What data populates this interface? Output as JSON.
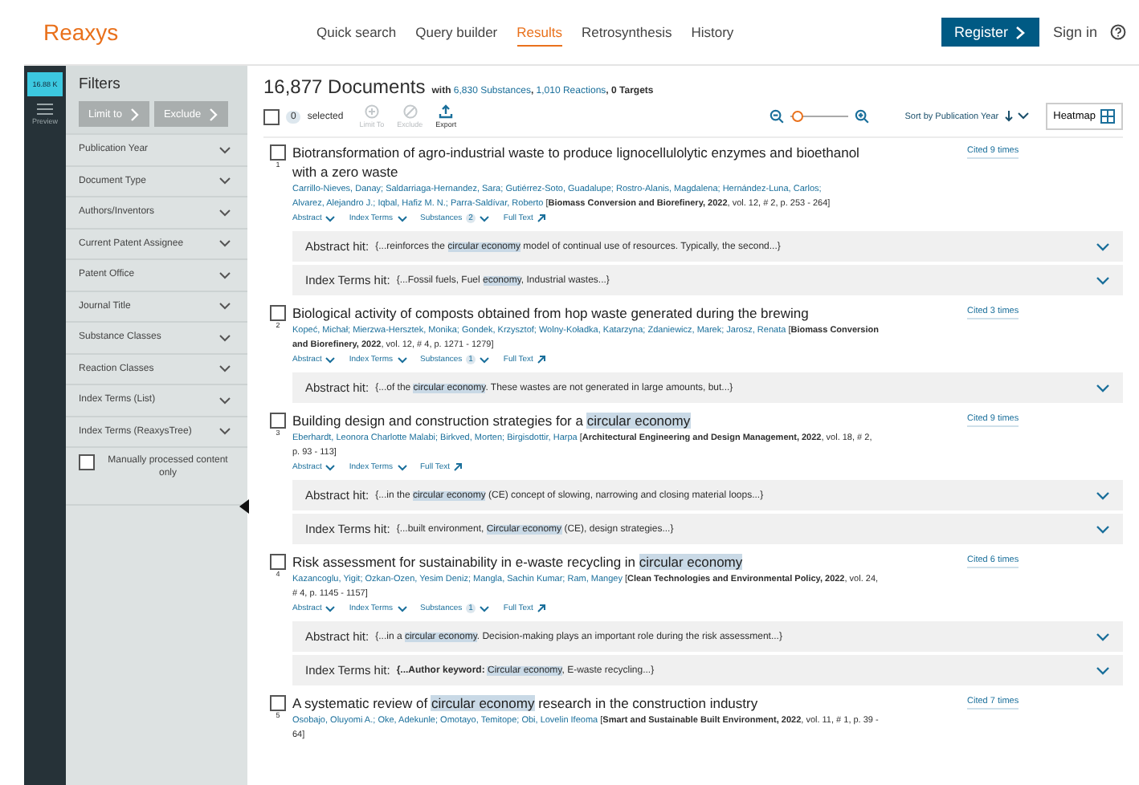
{
  "header": {
    "logo": "Reaxys",
    "nav": [
      {
        "label": "Quick search",
        "selected": false
      },
      {
        "label": "Query builder",
        "selected": false
      },
      {
        "label": "Results",
        "selected": true
      },
      {
        "label": "Retrosynthesis",
        "selected": false
      },
      {
        "label": "History",
        "selected": false
      }
    ],
    "register": "Register",
    "sign_in": "Sign in"
  },
  "rail": {
    "count": "16.88 K",
    "preview": "Preview"
  },
  "filters": {
    "title": "Filters",
    "buttons": [
      "Limit to",
      "Exclude"
    ],
    "items": [
      "Publication Year",
      "Document Type",
      "Authors/Inventors",
      "Current Patent Assignee",
      "Patent Office",
      "Journal Title",
      "Substance Classes",
      "Reaction Classes",
      "Index Terms (List)",
      "Index Terms (ReaxysTree)"
    ],
    "checkbox": {
      "label": "Manually processed content only",
      "checked": false
    }
  },
  "results": {
    "count": "16,877 Documents",
    "summary": [
      {
        "text": "with "
      },
      {
        "text": "6,830 Substances",
        "link": true
      },
      {
        "text": ", "
      },
      {
        "text": "1,010 Reactions",
        "link": true
      },
      {
        "text": ", 0 Targets"
      }
    ]
  },
  "toolbar": {
    "all_checked": false,
    "selected_count": "0",
    "selected_label": "selected",
    "actions": [
      {
        "label": "Limit To",
        "kind": "limit",
        "disabled": true
      },
      {
        "label": "Exclude",
        "kind": "exclude",
        "disabled": true
      },
      {
        "label": "Export",
        "kind": "export",
        "disabled": false
      }
    ],
    "zoom": {
      "level": 0.1
    },
    "sort": "Sort by Publication Year",
    "heatmap": "Heatmap"
  },
  "records": [
    {
      "number": "1",
      "checked": false,
      "cited": "Cited 9 times",
      "title": [
        {
          "text": "Biotransformation of agro-industrial waste to produce lignocellulolytic enzymes and bioethanol with a zero waste"
        }
      ],
      "authors": [
        "Carrillo-Nieves, Danay;",
        "Saldarriaga-Hernandez, Sara;",
        "Gutiérrez-Soto, Guadalupe;",
        "Rostro-Alanis, Magdalena;",
        "Hernández-Luna, Carlos;",
        "Alvarez, Alejandro J.;",
        "Iqbal, Hafiz M. N.;",
        "Parra-Saldívar, Roberto"
      ],
      "source": "[**Biomass Conversion and Biorefinery, 2022**, vol. 12, # 2, p. 253 - 264]",
      "links": [
        {
          "label": "Abstract",
          "kind": "dropdown"
        },
        {
          "label": "Index Terms",
          "kind": "dropdown"
        },
        {
          "label": "Substances",
          "kind": "dropdown",
          "count": "2"
        },
        {
          "label": "Full Text",
          "kind": "external"
        }
      ],
      "hits": [
        {
          "label": "Abstract hit:",
          "text": [
            {
              "text": "{...reinforces the "
            },
            {
              "text": "circular economy",
              "hl": true
            },
            {
              "text": " model of continual use of resources. Typically, the second...}"
            }
          ]
        },
        {
          "label": "Index Terms hit:",
          "text": [
            {
              "text": "{...Fossil fuels, Fuel "
            },
            {
              "text": "economy",
              "hl": true
            },
            {
              "text": ", Industrial wastes...}"
            }
          ]
        }
      ]
    },
    {
      "number": "2",
      "checked": false,
      "cited": "Cited 3 times",
      "title": [
        {
          "text": "Biological activity of composts obtained from hop waste generated during the brewing"
        }
      ],
      "authors": [
        "Kopeć, Michał;",
        "Mierzwa-Hersztek, Monika;",
        "Gondek, Krzysztof;",
        "Wolny-Koładka, Katarzyna;",
        "Zdaniewicz, Marek;",
        "Jarosz, Renata"
      ],
      "source": "[**Biomass Conversion and Biorefinery, 2022**, vol. 12, # 4, p. 1271 - 1279]",
      "links": [
        {
          "label": "Abstract",
          "kind": "dropdown"
        },
        {
          "label": "Index Terms",
          "kind": "dropdown"
        },
        {
          "label": "Substances",
          "kind": "dropdown",
          "count": "1"
        },
        {
          "label": "Full Text",
          "kind": "external"
        }
      ],
      "hits": [
        {
          "label": "Abstract hit:",
          "text": [
            {
              "text": "{...of the "
            },
            {
              "text": "circular economy",
              "hl": true
            },
            {
              "text": ". These wastes are not generated in large amounts, but...}"
            }
          ]
        }
      ]
    },
    {
      "number": "3",
      "checked": false,
      "cited": "Cited 9 times",
      "title": [
        {
          "text": "Building design and construction strategies for a "
        },
        {
          "text": "circular economy",
          "hl": true
        }
      ],
      "authors": [
        "Eberhardt, Leonora Charlotte Malabi;",
        "Birkved, Morten;",
        "Birgisdottir, Harpa"
      ],
      "source": "[**Architectural Engineering and Design Management, 2022**, vol. 18, # 2, p. 93 - 113]",
      "links": [
        {
          "label": "Abstract",
          "kind": "dropdown"
        },
        {
          "label": "Index Terms",
          "kind": "dropdown"
        },
        {
          "label": "Full Text",
          "kind": "external"
        }
      ],
      "hits": [
        {
          "label": "Abstract hit:",
          "text": [
            {
              "text": "{...in the "
            },
            {
              "text": "circular economy",
              "hl": true
            },
            {
              "text": " (CE) concept of slowing, narrowing and closing material loops...}"
            }
          ]
        },
        {
          "label": "Index Terms hit:",
          "text": [
            {
              "text": "{...built environment, "
            },
            {
              "text": "Circular economy",
              "hl": true
            },
            {
              "text": " (CE), design strategies...}"
            }
          ]
        }
      ]
    },
    {
      "number": "4",
      "checked": false,
      "cited": "Cited 6 times",
      "title": [
        {
          "text": "Risk assessment for sustainability in e-waste recycling in "
        },
        {
          "text": "circular economy",
          "hl": true
        }
      ],
      "authors": [
        "Kazancoglu, Yigit;",
        "Ozkan-Ozen, Yesim Deniz;",
        "Mangla, Sachin Kumar;",
        "Ram, Mangey"
      ],
      "source": "[**Clean Technologies and Environmental Policy, 2022**, vol. 24, # 4, p. 1145 - 1157]",
      "links": [
        {
          "label": "Abstract",
          "kind": "dropdown"
        },
        {
          "label": "Index Terms",
          "kind": "dropdown"
        },
        {
          "label": "Substances",
          "kind": "dropdown",
          "count": "1"
        },
        {
          "label": "Full Text",
          "kind": "external"
        }
      ],
      "hits": [
        {
          "label": "Abstract hit:",
          "text": [
            {
              "text": "{...in a "
            },
            {
              "text": "circular economy",
              "hl": true
            },
            {
              "text": ". Decision-making plays an important role during the risk assessment...}"
            }
          ]
        },
        {
          "label": "Index Terms hit:",
          "text": [
            {
              "text": "{...Author keyword: ",
              "bold": true
            },
            {
              "text": "Circular economy",
              "hl": true
            },
            {
              "text": ", E-waste recycling...}"
            }
          ]
        }
      ]
    },
    {
      "number": "5",
      "checked": false,
      "cited": "Cited 7 times",
      "title": [
        {
          "text": "A systematic review of "
        },
        {
          "text": "circular economy",
          "hl": true
        },
        {
          "text": " research in the construction industry"
        }
      ],
      "authors": [
        "Osobajo, Oluyomi A.;",
        "Oke, Adekunle;",
        "Omotayo, Temitope;",
        "Obi, Lovelin Ifeoma"
      ],
      "source": "[**Smart and Sustainable Built Environment, 2022**, vol. 11, # 1, p. 39 - 64]"
    }
  ]
}
